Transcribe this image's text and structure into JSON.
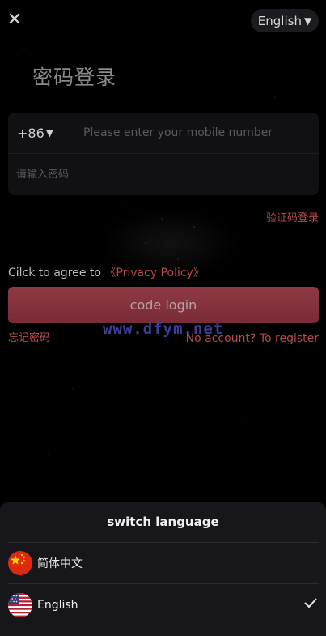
{
  "header": {
    "close_glyph": "✕",
    "language_selector": {
      "label": "English",
      "caret": "▼"
    }
  },
  "login": {
    "title": "密码登录",
    "country_code": "+86",
    "country_caret": "▼",
    "phone_placeholder": "Please enter your mobile number",
    "password_placeholder": "请输入密码",
    "switch_to_code_login": "验证码登录",
    "agree_prefix": "Cilck to agree to",
    "privacy_policy": "《Privacy Policy》",
    "submit_label": "code login",
    "forgot_password": "忘记密码",
    "register": "No account? To register"
  },
  "watermark": "www.dfym.net",
  "language_sheet": {
    "title": "switch language",
    "options": [
      {
        "label": "简体中文",
        "flag": "china-flag-icon",
        "selected": false
      },
      {
        "label": "English",
        "flag": "usa-flag-icon",
        "selected": true
      }
    ]
  },
  "colors": {
    "accent": "#b84a4a",
    "button": "#8f3a44",
    "background": "#000000",
    "sheet": "#17171b"
  }
}
